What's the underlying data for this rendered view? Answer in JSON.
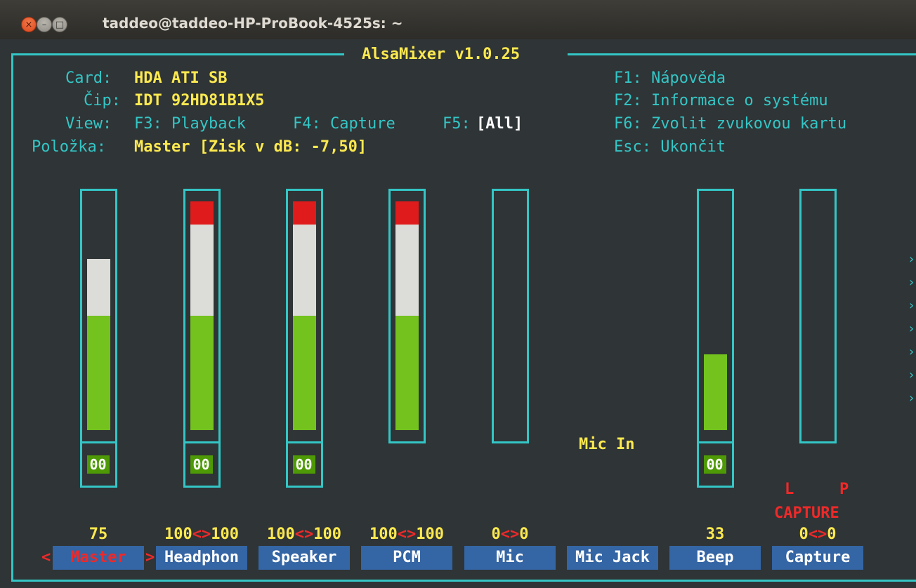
{
  "window": {
    "title": "taddeo@taddeo-HP-ProBook-4525s: ~"
  },
  "mixer": {
    "title": "AlsaMixer v1.0.25",
    "info": {
      "card_label": "Card:",
      "card_value": "HDA ATI SB",
      "chip_label": "Čip:",
      "chip_value": "IDT 92HD81B1X5",
      "view_label": "View:",
      "view_playback": "F3: Playback",
      "view_capture": "F4: Capture",
      "view_all_key": "F5:",
      "view_all": "[All]",
      "item_label": "Položka:",
      "item_value": "Master [Zisk v dB: -7,50]"
    },
    "help": [
      "F1: Nápověda",
      "F2: Informace o systému",
      "F6: Zvolit zvukovou kartu",
      "Esc: Ukončit"
    ],
    "mic_in_label": "Mic In",
    "capture_l": "L",
    "capture_p": "P",
    "capture_label": "CAPTURE",
    "selected_left_marker": "<",
    "selected_right_marker": ">",
    "channels": [
      {
        "name": "Master",
        "volume_display": "75",
        "left": "",
        "sep": "",
        "right": "",
        "level": 0.75,
        "mute": "00",
        "selected": true
      },
      {
        "name": "Headphon",
        "volume_display": "",
        "left": "100",
        "sep": "<>",
        "right": "100",
        "level": 1.0,
        "mute": "00"
      },
      {
        "name": "Speaker",
        "volume_display": "",
        "left": "100",
        "sep": "<>",
        "right": "100",
        "level": 1.0,
        "mute": "00"
      },
      {
        "name": "PCM",
        "volume_display": "",
        "left": "100",
        "sep": "<>",
        "right": "100",
        "level": 1.0
      },
      {
        "name": "Mic",
        "volume_display": "",
        "left": "0",
        "sep": "<>",
        "right": "0",
        "level": 0.0
      },
      {
        "name": "Mic Jack"
      },
      {
        "name": "Beep",
        "volume_display": "33",
        "left": "",
        "sep": "",
        "right": "",
        "level": 0.33,
        "mute": "00"
      },
      {
        "name": "Capture",
        "volume_display": "",
        "left": "0",
        "sep": "<>",
        "right": "0",
        "level": 0.0
      }
    ]
  },
  "colors": {
    "accent": "#34c6c6",
    "label": "#fce94f",
    "muted_bg": "#4e9a06",
    "name_bg": "#3465a4",
    "warn": "#ef2929"
  }
}
